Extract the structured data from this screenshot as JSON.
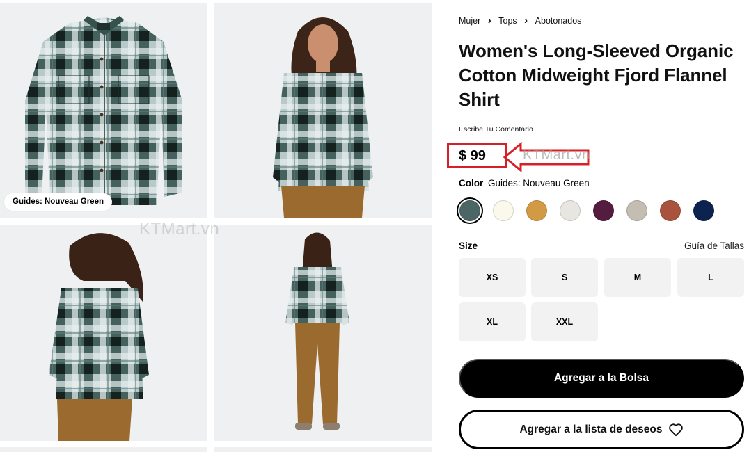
{
  "gallery": {
    "color_tag": "Guides: Nouveau Green",
    "watermark": "KTMart.vn",
    "images": [
      "shirt-front-flat",
      "model-front",
      "model-back",
      "model-full-length",
      "next-image-top",
      "next-image-top"
    ]
  },
  "breadcrumb": [
    "Mujer",
    "Tops",
    "Abotonados"
  ],
  "product": {
    "title": "Women's Long-Sleeved Organic Cotton Midweight Fjord Flannel Shirt",
    "review_link": "Escribe Tu Comentario",
    "price": "$ 99",
    "price_annotation_watermark": "KTMart.vn",
    "annotation_color": "#d62027"
  },
  "color": {
    "label": "Color",
    "selected_name": "Guides: Nouveau Green",
    "swatches": [
      {
        "name": "nouveau-green",
        "hex": "#4c6666",
        "selected": true
      },
      {
        "name": "cream",
        "hex": "#fbf8ec",
        "selected": false
      },
      {
        "name": "tan",
        "hex": "#d39a45",
        "selected": false
      },
      {
        "name": "light-gray",
        "hex": "#e8e6e1",
        "selected": false
      },
      {
        "name": "plum",
        "hex": "#541c3f",
        "selected": false
      },
      {
        "name": "stone",
        "hex": "#c3bdb2",
        "selected": false
      },
      {
        "name": "rust",
        "hex": "#a9533f",
        "selected": false
      },
      {
        "name": "navy",
        "hex": "#0c2350",
        "selected": false
      }
    ]
  },
  "size": {
    "label": "Size",
    "guide_link": "Guía de Tallas",
    "options": [
      "XS",
      "S",
      "M",
      "L",
      "XL",
      "XXL"
    ]
  },
  "actions": {
    "add_to_bag": "Agregar a la Bolsa",
    "add_to_wishlist": "Agregar a la lista de deseos"
  }
}
